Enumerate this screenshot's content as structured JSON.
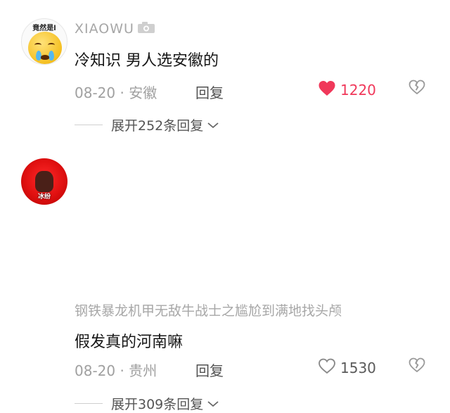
{
  "comments": [
    {
      "avatar_caption": "竟然是l",
      "username": "XIAOWU",
      "content": "冷知识 男人选安徽的",
      "date": "08-20",
      "location": "安徽",
      "reply_label": "回复",
      "likes": "1220",
      "liked": true,
      "expand_label": "展开252条回复"
    },
    {
      "avatar_caption": "冰纷",
      "username": "钢铁暴龙机甲无敌牛战士之尴尬到满地找头颅",
      "content": "假发真的河南嘛",
      "date": "08-20",
      "location": "贵州",
      "reply_label": "回复",
      "likes": "1530",
      "liked": false,
      "expand_label": "展开309条回复"
    }
  ],
  "colors": {
    "liked": "#f0385a",
    "meta": "#a0a0a0",
    "text": "#161616"
  },
  "icons": [
    "camera-icon",
    "heart-filled-icon",
    "heart-outline-icon",
    "broken-heart-icon",
    "chevron-down-icon"
  ]
}
